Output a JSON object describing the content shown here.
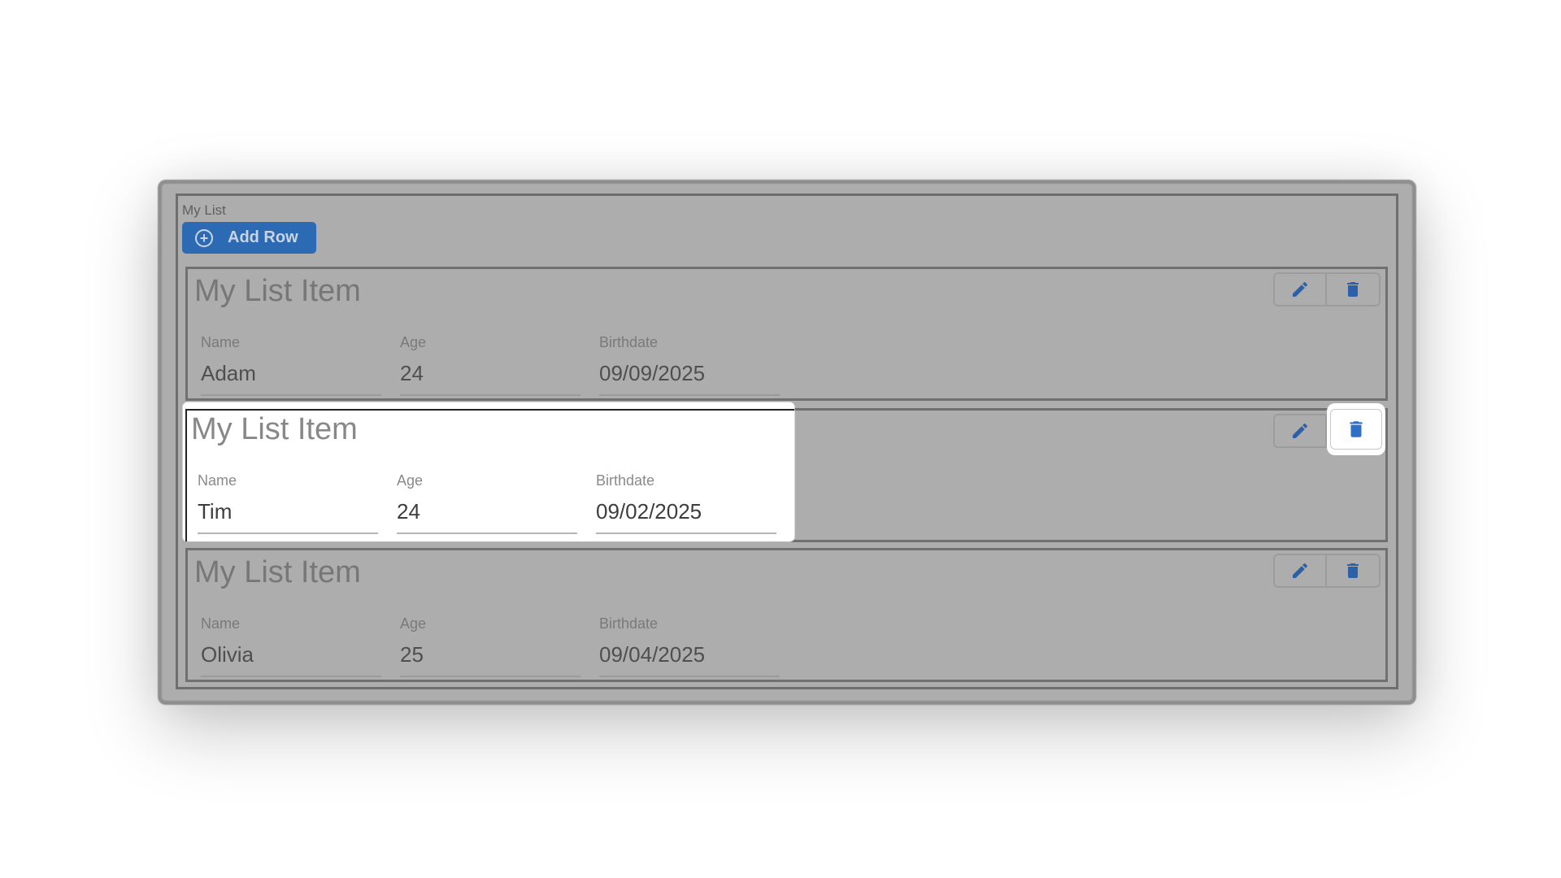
{
  "list": {
    "label": "My List",
    "add_row_label": "Add Row"
  },
  "items": [
    {
      "title": "My List Item",
      "fields": [
        {
          "label": "Name",
          "value": "Adam"
        },
        {
          "label": "Age",
          "value": "24"
        },
        {
          "label": "Birthdate",
          "value": "09/09/2025"
        }
      ],
      "highlighted": false
    },
    {
      "title": "My List Item",
      "fields": [
        {
          "label": "Name",
          "value": "Tim"
        },
        {
          "label": "Age",
          "value": "24"
        },
        {
          "label": "Birthdate",
          "value": "09/02/2025"
        }
      ],
      "highlighted": true
    },
    {
      "title": "My List Item",
      "fields": [
        {
          "label": "Name",
          "value": "Olivia"
        },
        {
          "label": "Age",
          "value": "25"
        },
        {
          "label": "Birthdate",
          "value": "09/04/2025"
        }
      ],
      "highlighted": false
    }
  ],
  "icons": {
    "add": "plus-circle-icon",
    "edit": "pencil-icon",
    "delete": "trash-icon"
  },
  "colors": {
    "accent": "#2c6bb4",
    "icon_blue": "#2f6fc4",
    "dim_overlay": "#adadad"
  }
}
